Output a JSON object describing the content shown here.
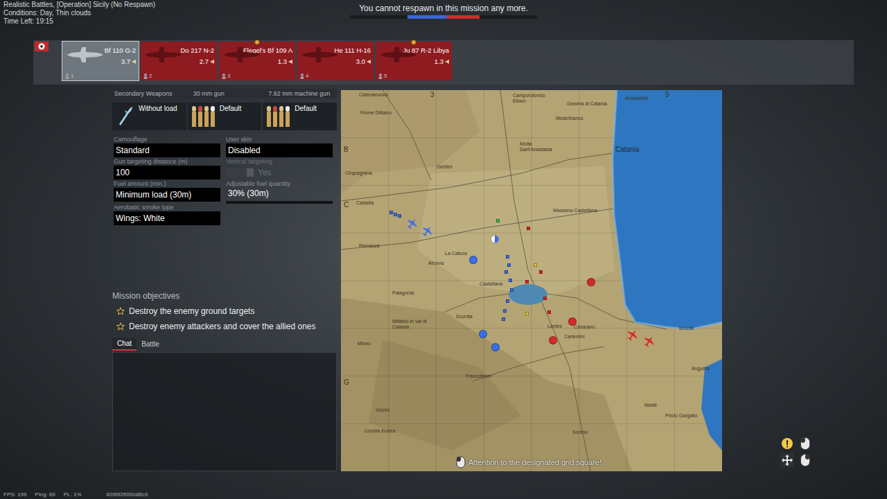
{
  "mission": {
    "title": "Realistic Battles, [Operation] Sicily (No Respawn)",
    "conditions": "Conditions: Day, Thin clouds",
    "time_left": "Time Left: 19:15"
  },
  "notice": {
    "text": "You cannot respawn in this mission any more.",
    "allies_level": 0.42,
    "enemies_level": 0.35
  },
  "lineup": [
    {
      "name": "Bf 110 G-2",
      "br": "3.7",
      "slot": "1",
      "selected": true,
      "locked": false,
      "badge": false
    },
    {
      "name": "Do 217 N-2",
      "br": "2.7",
      "slot": "2",
      "selected": false,
      "locked": true,
      "badge": false
    },
    {
      "name": "Flegel's Bf 109 A",
      "br": "1.3",
      "slot": "3",
      "selected": false,
      "locked": true,
      "badge": true
    },
    {
      "name": "He 111 H-16",
      "br": "3.0",
      "slot": "4",
      "selected": false,
      "locked": true,
      "badge": false
    },
    {
      "name": "Ju 87 R-2 Libya",
      "br": "1.3",
      "slot": "5",
      "selected": false,
      "locked": true,
      "badge": true
    }
  ],
  "weapons": {
    "headers": [
      "Secondary Weapons",
      "30 mm gun",
      "7.92 mm machine gun"
    ],
    "values": [
      {
        "label": "Without load",
        "kind": "bomb"
      },
      {
        "label": "Default",
        "kind": "belt"
      },
      {
        "label": "Default",
        "kind": "belt"
      }
    ]
  },
  "settings": [
    {
      "label": "Camouflage",
      "value": "Standard",
      "kind": "select",
      "disabled": false
    },
    {
      "label": "User skin",
      "value": "Disabled",
      "kind": "select",
      "disabled": false
    },
    {
      "label": "Gun targeting distance (m)",
      "value": "100",
      "kind": "select",
      "disabled": false
    },
    {
      "label": "Vertical targeting",
      "value": "Yes",
      "kind": "toggle",
      "disabled": true
    },
    {
      "label": "Fuel amount (min.)",
      "value": "Minimum load (30m)",
      "kind": "select",
      "disabled": false
    },
    {
      "label": "Adjustable fuel quantity",
      "value": "30% (30m)",
      "kind": "slider",
      "disabled": false,
      "level": 0
    },
    {
      "label": "Aerobatic smoke type",
      "value": "Wings: White",
      "kind": "select",
      "disabled": false
    }
  ],
  "objectives": {
    "title": "Mission objectives",
    "items": [
      "Destroy the enemy ground targets",
      "Destroy enemy attackers and cover the allied ones"
    ]
  },
  "chat": {
    "tabs": [
      {
        "label": "Chat",
        "selected": true
      },
      {
        "label": "Battle",
        "selected": false
      }
    ]
  },
  "map": {
    "grid_columns": [
      "3",
      "9"
    ],
    "grid_rows": [
      "B",
      "C",
      "G"
    ],
    "places": [
      "Catenanuova",
      "Camporotondo Etneo",
      "Gravina di Catania",
      "Acicastello",
      "Misterbianco",
      "Catania",
      "Fiume Dittaino",
      "Motta Sant'Anastasia",
      "Gerbini",
      "Cirquegrana",
      "Castella",
      "Ramacca",
      "Alcovia",
      "La Callura",
      "Castellana",
      "Palagonia",
      "Scordia",
      "Militello in Val di Catania",
      "Lentini",
      "Carlentini",
      "Casarano",
      "Masseria Castellana",
      "Francofonte",
      "Mineo",
      "Vizzini",
      "Licodia Eubea",
      "Sortino",
      "Melilli",
      "Priolo Gargallo",
      "Augusta",
      "Brucoli"
    ],
    "markers": [
      {
        "kind": "plane",
        "color": "#3a6ee8"
      },
      {
        "kind": "plane",
        "color": "#3a6ee8"
      },
      {
        "kind": "plane",
        "color": "#e02424"
      },
      {
        "kind": "plane",
        "color": "#e02424"
      },
      {
        "kind": "unit",
        "color": "#3a6ee8"
      },
      {
        "kind": "unit",
        "color": "#3a6ee8"
      },
      {
        "kind": "unit",
        "color": "#3a6ee8"
      },
      {
        "kind": "point",
        "color": "#3a6ee8"
      },
      {
        "kind": "point",
        "color": "#3a6ee8"
      },
      {
        "kind": "point",
        "color": "#3a6ee8"
      },
      {
        "kind": "point",
        "color": "#d52a2a"
      },
      {
        "kind": "point",
        "color": "#d52a2a"
      },
      {
        "kind": "point",
        "color": "#d52a2a"
      },
      {
        "kind": "airfield",
        "color": "#3a6ee8"
      },
      {
        "kind": "unit",
        "color": "#e02424"
      },
      {
        "kind": "unit",
        "color": "#3cbf3c"
      },
      {
        "kind": "unit",
        "color": "#3a6ee8"
      },
      {
        "kind": "unit",
        "color": "#3a6ee8"
      },
      {
        "kind": "unit",
        "color": "#3a6ee8"
      },
      {
        "kind": "unit",
        "color": "#3a6ee8"
      },
      {
        "kind": "unit",
        "color": "#3a6ee8"
      },
      {
        "kind": "unit",
        "color": "#3a6ee8"
      },
      {
        "kind": "unit",
        "color": "#3a6ee8"
      },
      {
        "kind": "unit",
        "color": "#3a6ee8"
      },
      {
        "kind": "unit",
        "color": "#e02424"
      },
      {
        "kind": "unit",
        "color": "#e02424"
      },
      {
        "kind": "unit",
        "color": "#e02424"
      },
      {
        "kind": "unit",
        "color": "#e02424"
      },
      {
        "kind": "unit",
        "color": "#e8c83a"
      },
      {
        "kind": "unit",
        "color": "#e8c83a"
      }
    ],
    "message": "Attention to the designated grid square!"
  },
  "status_bar": [
    "FPS: 199",
    "Ping: 89",
    "PL: 1%",
    "6095f2f000d8fc9"
  ]
}
